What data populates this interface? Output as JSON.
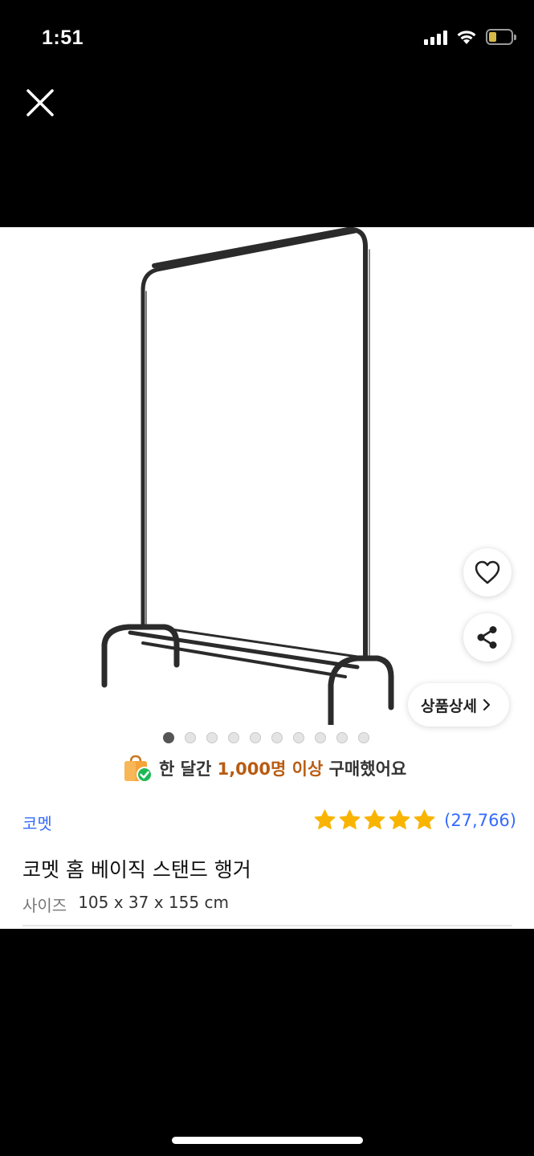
{
  "status_bar": {
    "time": "1:51",
    "battery_level": "8",
    "icons": [
      "signal-icon",
      "wifi-icon",
      "battery-icon"
    ]
  },
  "header": {
    "close_icon": "close-icon"
  },
  "gallery": {
    "image_count": 10,
    "active_index": 0,
    "detail_button_label": "상품상세",
    "icons": [
      "heart-icon",
      "share-icon",
      "chevron-right-icon"
    ]
  },
  "purchase_banner": {
    "prefix": "한 달간",
    "highlight": "1,000명 이상",
    "suffix": "구매했어요",
    "icon": "shopping-bag-check-icon"
  },
  "product": {
    "brand": "코멧",
    "rating_stars": 5,
    "review_count": "(27,766)",
    "title": "코멧 홈 베이직 스탠드 행거",
    "spec_label": "사이즈",
    "spec_value": "105 x 37 x 155 cm"
  },
  "colors": {
    "link_blue": "#346aff",
    "star_gold": "#f9b400",
    "highlight_orange": "#b85c12"
  }
}
